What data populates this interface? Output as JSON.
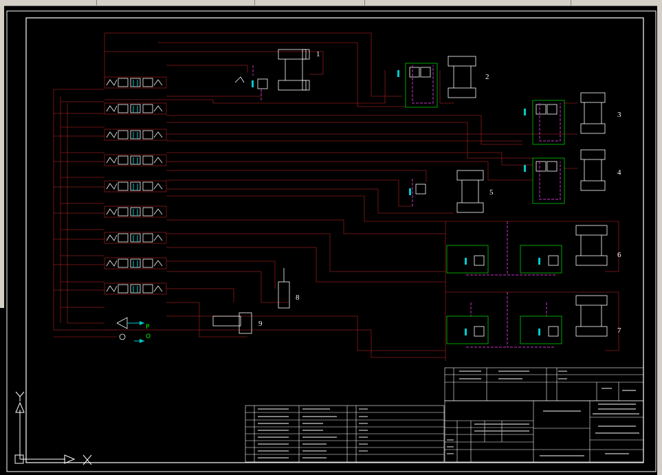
{
  "window": {
    "toolbar_segments": [
      "file-tabs",
      "layers",
      "styles",
      "properties"
    ]
  },
  "colors": {
    "background": "#000000",
    "frame": "#ffffff",
    "circuit_line": "#8b1a1a",
    "subframe": "#00cc00",
    "pilot": "#cc33cc",
    "accent": "#00cccc"
  },
  "drawing": {
    "component_labels": [
      "1",
      "2",
      "3",
      "4",
      "5",
      "6",
      "7",
      "8",
      "9"
    ],
    "port_labels": {
      "pressure": "P",
      "tank": "O"
    }
  },
  "ucs": {
    "x": "X",
    "y": "Y"
  }
}
